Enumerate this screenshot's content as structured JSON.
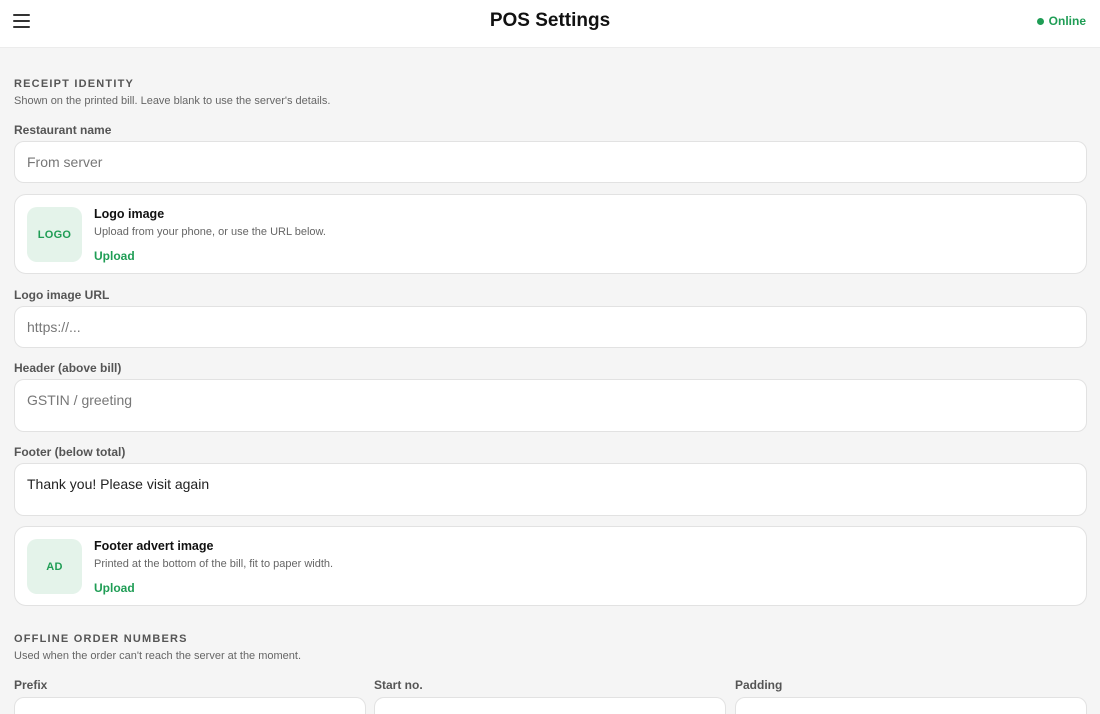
{
  "header": {
    "title": "POS Settings",
    "status_label": "Online",
    "status_color": "#1f9d55",
    "menu_icon": "hamburger-menu-icon"
  },
  "receipt_identity": {
    "title": "RECEIPT IDENTITY",
    "subtitle": "Shown on the printed bill. Leave blank to use the server's details.",
    "restaurant_name": {
      "label": "Restaurant name",
      "placeholder": "From server",
      "value": ""
    },
    "logo_card": {
      "thumb": "LOGO",
      "title": "Logo image",
      "subtitle": "Upload from your phone, or use the URL below.",
      "action": "Upload"
    },
    "logo_url": {
      "label": "Logo image URL",
      "placeholder": "https://...",
      "value": ""
    },
    "header_text": {
      "label": "Header (above bill)",
      "placeholder": "GSTIN / greeting",
      "value": ""
    },
    "footer_text": {
      "label": "Footer (below total)",
      "placeholder": "",
      "value": "Thank you! Please visit again"
    },
    "advert_card": {
      "thumb": "AD",
      "title": "Footer advert image",
      "subtitle": "Printed at the bottom of the bill, fit to paper width.",
      "action": "Upload"
    }
  },
  "offline_numbers": {
    "title": "OFFLINE ORDER NUMBERS",
    "subtitle": "Used when the order can't reach the server at the moment.",
    "prefix_label": "Prefix",
    "start_label": "Start no.",
    "padding_label": "Padding"
  },
  "accent_color": "#1f9d55"
}
